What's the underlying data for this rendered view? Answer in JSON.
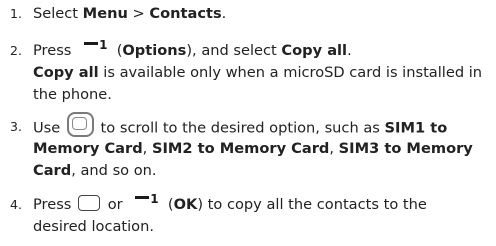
{
  "steps": [
    {
      "number": "1.",
      "text_a": "Select ",
      "bold_menu": "Menu",
      "text_b": " > ",
      "bold_contacts": "Contacts",
      "text_c": "."
    },
    {
      "number": "2.",
      "text_a": "Press ",
      "softkey_icon": "right-softkey-icon",
      "softkey_digit": "1",
      "text_b": " (",
      "bold_options": "Options",
      "text_c": "), and select ",
      "bold_copy_all": "Copy all",
      "text_d": ".",
      "note_bold": "Copy all",
      "note_line1": " is available only when a microSD card is installed in",
      "note_line2": "the phone."
    },
    {
      "number": "3.",
      "text_a": "Use ",
      "navkey_icon": "navigation-key-icon",
      "text_b": " to scroll to the desired option, such as ",
      "bold_opt1": "SIM1 to",
      "bold_opt1b": "Memory Card",
      "text_c": ", ",
      "bold_opt2": "SIM2 to Memory Card",
      "text_d": ", ",
      "bold_opt3": "SIM3 to Memory",
      "bold_opt3b": "Card",
      "text_e": ", and so on."
    },
    {
      "number": "4.",
      "text_a": "Press ",
      "ok_icon": "ok-key-icon",
      "text_b": " or ",
      "softkey_icon": "right-softkey-icon",
      "softkey_digit": "1",
      "text_c": " (",
      "bold_ok": "OK",
      "text_d": ") to copy all the contacts to the",
      "line2": "desired location."
    }
  ]
}
